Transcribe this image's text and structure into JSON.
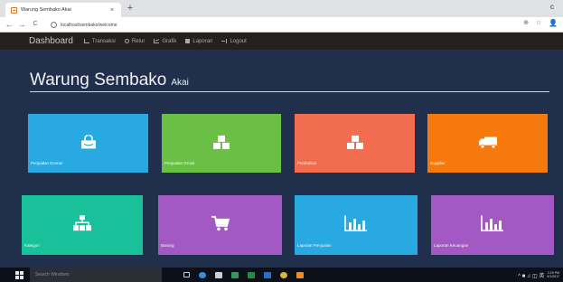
{
  "browser": {
    "tab_title": "Warung Sembako Akai",
    "tab_close": "×",
    "new_tab": "+",
    "window_control": "c",
    "url": "localhost/sembako/welcome",
    "back": "←",
    "forward": "→",
    "reload": "C",
    "zoom_icon": "⊕",
    "star_icon": "☆",
    "account_icon": "👤"
  },
  "nav": {
    "brand": "Dashboard",
    "items": [
      {
        "label": "Transaksi",
        "icon": "cart-icon"
      },
      {
        "label": "Retur",
        "icon": "refresh-icon"
      },
      {
        "label": "Grafik",
        "icon": "line-chart-icon"
      },
      {
        "label": "Laporan",
        "icon": "book-icon"
      },
      {
        "label": "Logout",
        "icon": "logout-icon"
      }
    ]
  },
  "heading": {
    "title": "Warung Sembako",
    "subtitle": "Akai"
  },
  "tiles": [
    {
      "label": "Penjualan Eceran",
      "icon": "shopping-bag-icon",
      "color": "#29a9e1"
    },
    {
      "label": "Penjualan Grosir",
      "icon": "cubes-icon",
      "color": "#6abf45"
    },
    {
      "label": "Pembelian",
      "icon": "cubes-icon",
      "color": "#f26c4f"
    },
    {
      "label": "Supplier",
      "icon": "truck-icon",
      "color": "#f5790c"
    },
    {
      "label": "Kategori",
      "icon": "sitemap-icon",
      "color": "#19c19b"
    },
    {
      "label": "Barang",
      "icon": "cart-icon",
      "color": "#a259c4"
    },
    {
      "label": "Laporan Penjualan",
      "icon": "bar-chart-icon",
      "color": "#29a9e1"
    },
    {
      "label": "Laporan Keuangan",
      "icon": "bar-chart-icon",
      "color": "#a259c4"
    }
  ],
  "taskbar": {
    "search_placeholder": "Search Windows",
    "clock_time": "2:29 PM",
    "clock_date": "5/1/2017",
    "tray": "^ ■ ♫ ◫ 英"
  }
}
